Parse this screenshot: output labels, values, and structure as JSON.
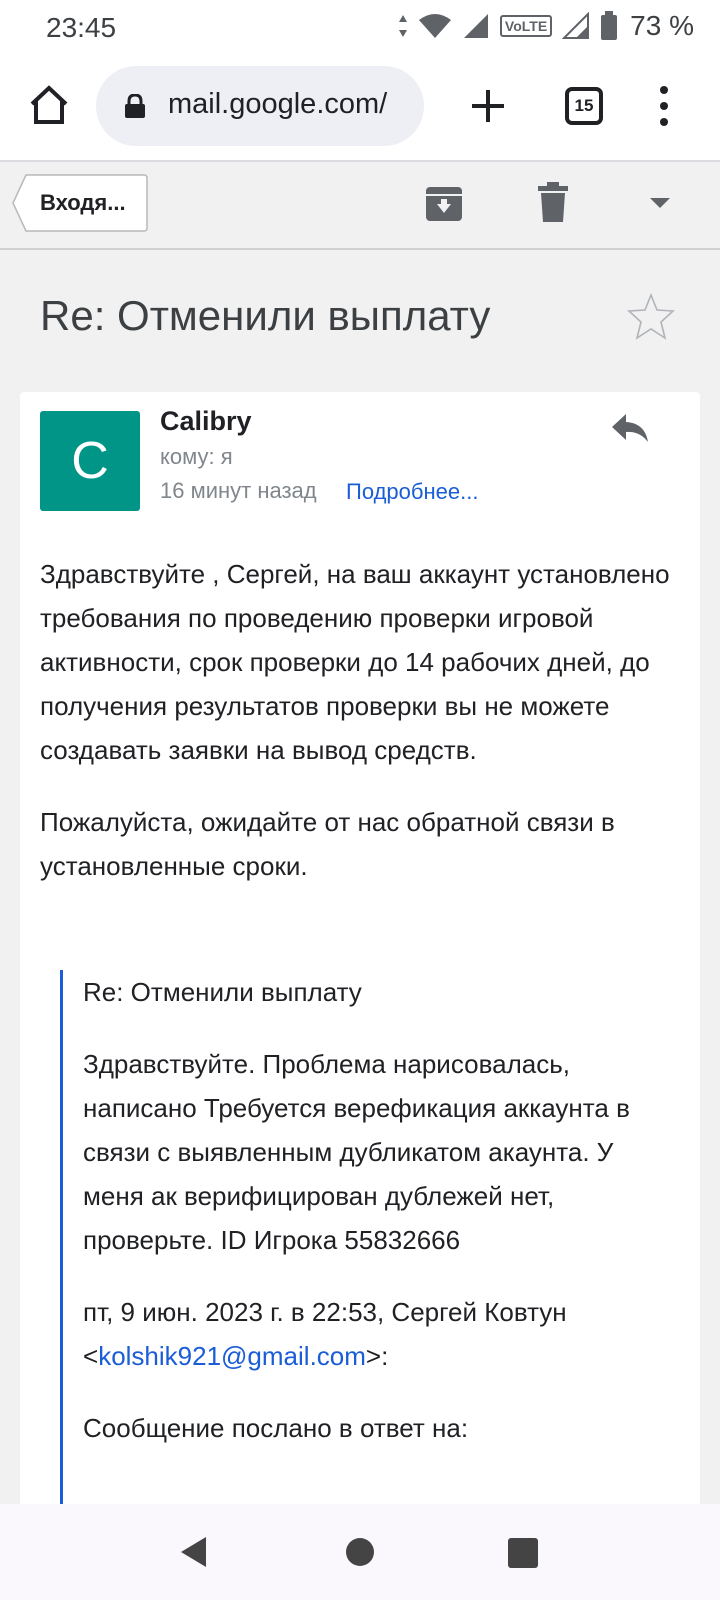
{
  "status_bar": {
    "time": "23:45",
    "volte_label": "VoLTE",
    "battery_percent": "73 %"
  },
  "browser": {
    "url": "mail.google.com/",
    "tab_count": "15"
  },
  "gmail_toolbar": {
    "back_label": "Входя..."
  },
  "message": {
    "subject": "Re: Отменили выплату",
    "avatar_letter": "C",
    "sender": "Calibry",
    "recipient": "кому: я",
    "time_ago": "16 минут назад",
    "details_link": "Подробнее...",
    "body": [
      "Здравствуйте , Сергей, на ваш аккаунт установлено требования по проведению проверки игровой активности, срок проверки до 14 рабочих дней, до получения результатов проверки вы не можете создавать заявки на вывод средств.",
      "Пожалуйста, ожидайте от нас обратной связи в установленные сроки."
    ],
    "quote": {
      "subject": "Re: Отменили выплату",
      "text": "Здравствуйте. Проблема нарисовалась, написано Требуется верефикация аккаунта в связи с выявленным дубликатом акаунта. У меня ак верифицирован дублежей нет, проверьте. ID Игрока 55832666",
      "attribution_prefix": "пт, 9 июн. 2023 г. в 22:53, Сергей Ковтун",
      "email_open": "<",
      "email": "kolshik921@gmail.com",
      "email_close": ">:",
      "reply_note": "Сообщение послано в ответ на:"
    }
  },
  "icons": {
    "home": "home-icon",
    "lock": "lock-icon",
    "plus": "plus-icon",
    "tabs": "tab-switcher-icon",
    "menu": "more-vert-icon",
    "archive": "archive-icon",
    "delete": "trash-icon",
    "dropdown": "caret-down-icon",
    "star": "star-outline-icon",
    "reply": "reply-icon"
  },
  "colors": {
    "avatar_bg": "#009587",
    "link": "#1a5dd6",
    "quote_border": "#1a5dd6"
  }
}
